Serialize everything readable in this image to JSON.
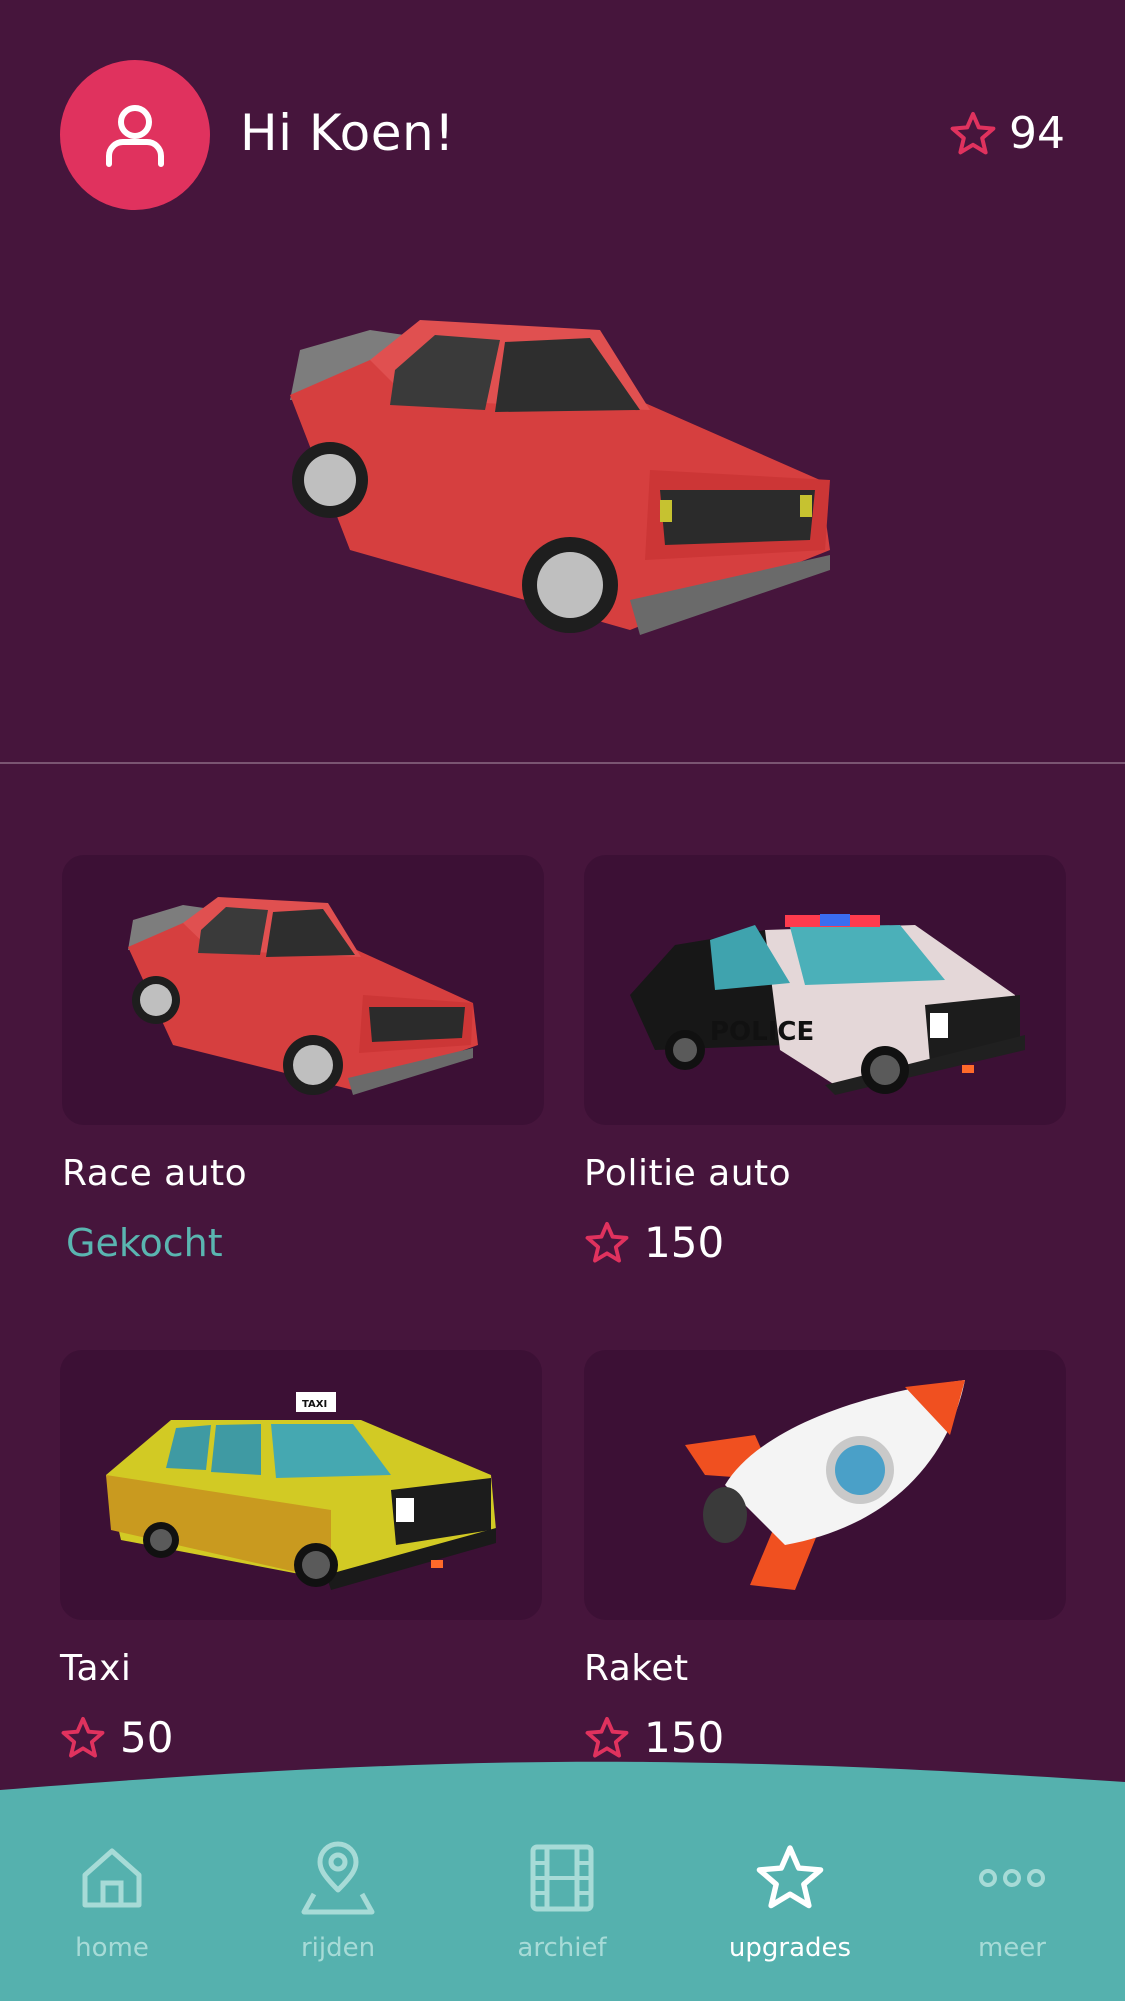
{
  "header": {
    "greeting": "Hi Koen!",
    "star_balance": "94"
  },
  "colors": {
    "background": "#46153c",
    "card_background": "#3c1035",
    "accent_pink": "#e0325e",
    "accent_teal": "#5ab5b0"
  },
  "shop": {
    "items": [
      {
        "name": "Race auto",
        "status": "Gekocht",
        "icon": "red-race-car"
      },
      {
        "name": "Politie auto",
        "price": "150",
        "icon": "police-car"
      },
      {
        "name": "Taxi",
        "price": "50",
        "icon": "taxi-car"
      },
      {
        "name": "Raket",
        "price": "150",
        "icon": "rocket"
      }
    ]
  },
  "nav": {
    "items": [
      {
        "label": "home",
        "icon": "home-icon"
      },
      {
        "label": "rijden",
        "icon": "map-pin-icon"
      },
      {
        "label": "archief",
        "icon": "film-icon"
      },
      {
        "label": "upgrades",
        "icon": "star-icon",
        "active": true
      },
      {
        "label": "meer",
        "icon": "more-dots-icon"
      }
    ]
  }
}
